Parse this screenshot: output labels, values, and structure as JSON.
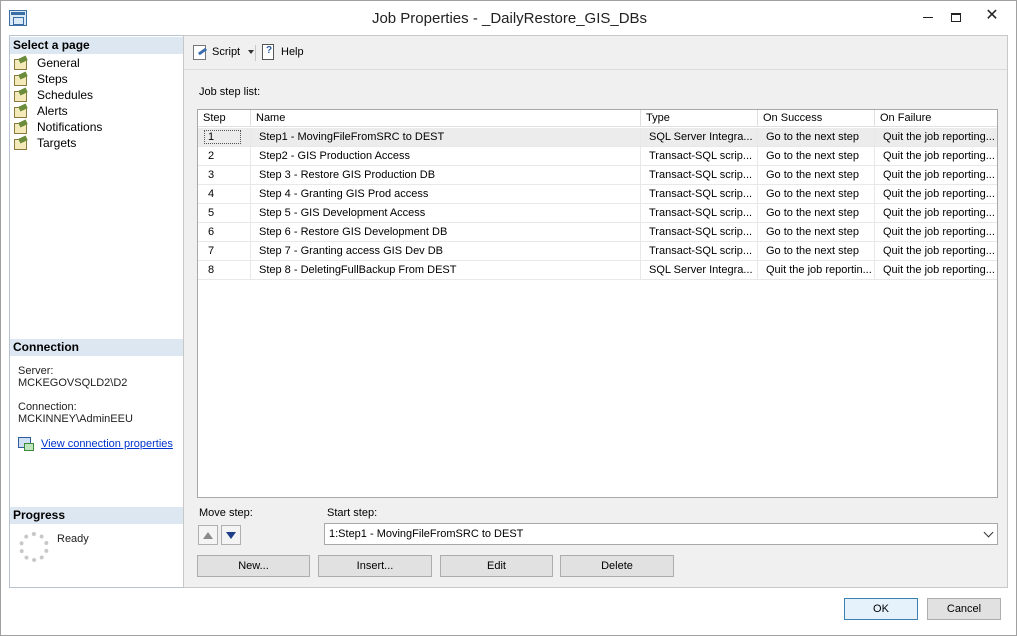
{
  "window": {
    "title": "Job Properties - _DailyRestore_GIS_DBs",
    "min_label": "",
    "max_label": "",
    "close_label": "✕"
  },
  "left_pane": {
    "select_header": "Select a page",
    "pages": [
      {
        "label": "General"
      },
      {
        "label": "Steps"
      },
      {
        "label": "Schedules"
      },
      {
        "label": "Alerts"
      },
      {
        "label": "Notifications"
      },
      {
        "label": "Targets"
      }
    ],
    "connection_header": "Connection",
    "server_label": "Server:",
    "server_value": "MCKEGOVSQLD2\\D2",
    "connection_label": "Connection:",
    "connection_value": "MCKINNEY\\AdminEEU",
    "view_link": "View connection properties",
    "progress_header": "Progress",
    "progress_status": "Ready"
  },
  "toolbar": {
    "script_label": "Script",
    "help_label": "Help"
  },
  "steps": {
    "list_label": "Job step list:",
    "columns": [
      "Step",
      "Name",
      "Type",
      "On Success",
      "On Failure"
    ],
    "rows": [
      {
        "step": "1",
        "name": "Step1 - MovingFileFromSRC to DEST",
        "type": "SQL Server Integra...",
        "on_success": "Go to the next step",
        "on_failure": "Quit the job reporting..."
      },
      {
        "step": "2",
        "name": "Step2 - GIS Production Access",
        "type": "Transact-SQL scrip...",
        "on_success": "Go to the next step",
        "on_failure": "Quit the job reporting..."
      },
      {
        "step": "3",
        "name": "Step 3 - Restore GIS Production DB",
        "type": "Transact-SQL scrip...",
        "on_success": "Go to the next step",
        "on_failure": "Quit the job reporting..."
      },
      {
        "step": "4",
        "name": "Step 4 - Granting GIS Prod access",
        "type": "Transact-SQL scrip...",
        "on_success": "Go to the next step",
        "on_failure": "Quit the job reporting..."
      },
      {
        "step": "5",
        "name": "Step 5 - GIS Development Access",
        "type": "Transact-SQL scrip...",
        "on_success": "Go to the next step",
        "on_failure": "Quit the job reporting..."
      },
      {
        "step": "6",
        "name": "Step 6 - Restore GIS Development DB",
        "type": "Transact-SQL scrip...",
        "on_success": "Go to the next step",
        "on_failure": "Quit the job reporting..."
      },
      {
        "step": "7",
        "name": "Step 7 - Granting access GIS Dev DB",
        "type": "Transact-SQL scrip...",
        "on_success": "Go to the next step",
        "on_failure": "Quit the job reporting..."
      },
      {
        "step": "8",
        "name": "Step 8  - DeletingFullBackup From DEST",
        "type": "SQL Server Integra...",
        "on_success": "Quit the job reportin...",
        "on_failure": "Quit the job reporting..."
      }
    ],
    "move_step_label": "Move step:",
    "start_step_label": "Start step:",
    "start_step_value": "1:Step1 - MovingFileFromSRC to DEST",
    "new_label": "New...",
    "insert_label": "Insert...",
    "edit_label": "Edit",
    "delete_label": "Delete"
  },
  "footer": {
    "ok_label": "OK",
    "cancel_label": "Cancel"
  }
}
